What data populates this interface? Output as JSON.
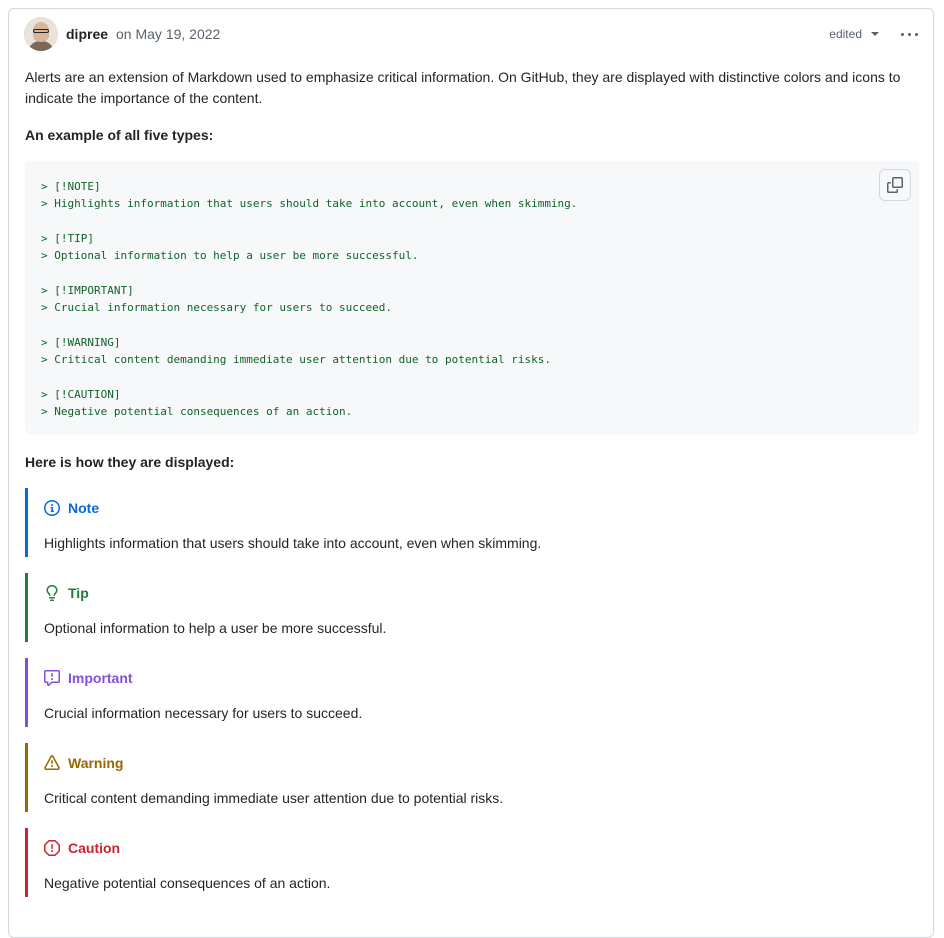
{
  "comment": {
    "author": "dipree",
    "date": "on May 19, 2022",
    "edited_label": "edited",
    "intro": "Alerts are an extension of Markdown used to emphasize critical information. On GitHub, they are displayed with distinctive colors and icons to indicate the importance of the content.",
    "example_heading": "An example of all five types:",
    "code_lines": [
      "> [!NOTE]",
      "> Highlights information that users should take into account, even when skimming.",
      "",
      "> [!TIP]",
      "> Optional information to help a user be more successful.",
      "",
      "> [!IMPORTANT]",
      "> Crucial information necessary for users to succeed.",
      "",
      "> [!WARNING]",
      "> Critical content demanding immediate user attention due to potential risks.",
      "",
      "> [!CAUTION]",
      "> Negative potential consequences of an action."
    ],
    "display_heading": "Here is how they are displayed:",
    "alerts": [
      {
        "title": "Note",
        "text": "Highlights information that users should take into account, even when skimming.",
        "color": "#0969da",
        "icon": "info-icon"
      },
      {
        "title": "Tip",
        "text": "Optional information to help a user be more successful.",
        "color": "#1a7f37",
        "icon": "lightbulb-icon"
      },
      {
        "title": "Important",
        "text": "Crucial information necessary for users to succeed.",
        "color": "#8250df",
        "icon": "report-icon"
      },
      {
        "title": "Warning",
        "text": "Critical content demanding immediate user attention due to potential risks.",
        "color": "#9a6700",
        "icon": "alert-icon"
      },
      {
        "title": "Caution",
        "text": "Negative potential consequences of an action.",
        "color": "#cf222e",
        "icon": "stop-icon"
      }
    ]
  }
}
